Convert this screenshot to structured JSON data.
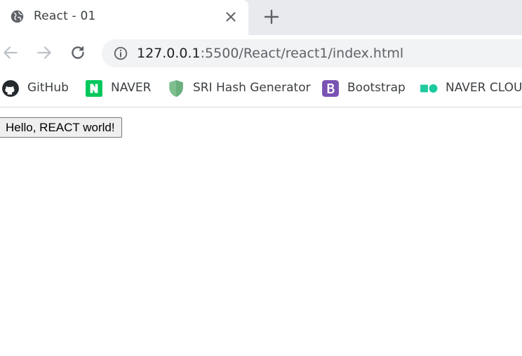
{
  "tab": {
    "title": "React - 01",
    "icon": "globe-icon"
  },
  "toolbar": {
    "back_icon": "back-arrow-icon",
    "forward_icon": "forward-arrow-icon",
    "reload_icon": "reload-icon",
    "url_host": "127.0.0.1",
    "url_path": ":5500/React/react1/index.html"
  },
  "bookmarks": [
    {
      "label": "GitHub",
      "icon": "github-icon"
    },
    {
      "label": "NAVER",
      "icon": "naver-icon"
    },
    {
      "label": "SRI Hash Generator",
      "icon": "shield-icon"
    },
    {
      "label": "Bootstrap",
      "icon": "bootstrap-icon"
    },
    {
      "label": "NAVER CLOU",
      "icon": "naver-cloud-icon"
    }
  ],
  "page": {
    "button_label": "Hello, REACT world!"
  },
  "colors": {
    "naver_green": "#03c75a",
    "bootstrap_purple": "#7952b3",
    "shield_green": "#7fbf8f",
    "cloud_green": "#1ec9a0"
  }
}
